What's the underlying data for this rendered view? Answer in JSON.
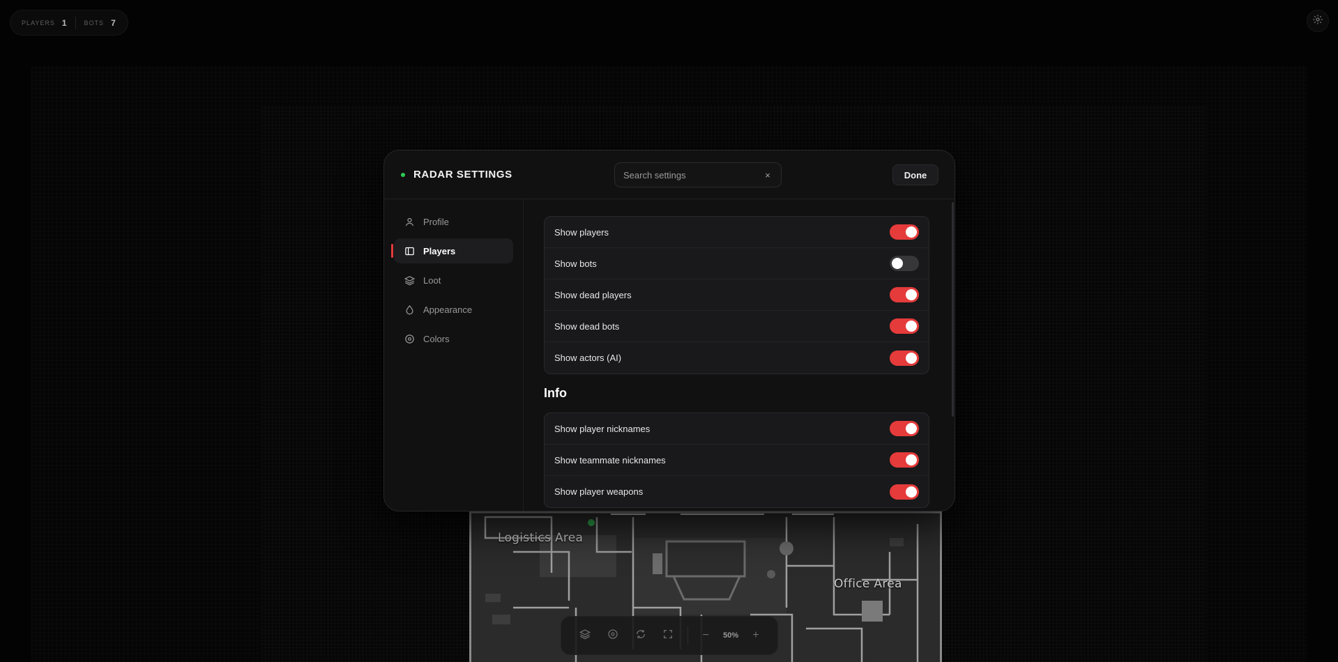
{
  "hud": {
    "players_label": "PLAYERS",
    "players_count": "1",
    "bots_label": "BOTS",
    "bots_count": "7",
    "settings_icon": "gear-icon"
  },
  "map": {
    "labels": [
      "Logistics Area",
      "Office Area"
    ]
  },
  "toolbar": {
    "buttons": [
      "layers-icon",
      "target-icon",
      "refresh-icon",
      "fullscreen-icon"
    ],
    "zoom_out": "−",
    "zoom_value": "50%",
    "zoom_in": "+"
  },
  "modal": {
    "title": "RADAR SETTINGS",
    "status_color": "#2ecc55",
    "search": {
      "placeholder": "Search settings",
      "value": "",
      "clear": "×"
    },
    "done_label": "Done",
    "nav": [
      {
        "label": "Profile",
        "icon": "user-icon",
        "active": false
      },
      {
        "label": "Players",
        "icon": "panel-icon",
        "active": true
      },
      {
        "label": "Loot",
        "icon": "layers-icon",
        "active": false
      },
      {
        "label": "Appearance",
        "icon": "droplet-icon",
        "active": false
      },
      {
        "label": "Colors",
        "icon": "target-icon",
        "active": false
      }
    ],
    "accent_color": "#e53b3b",
    "groups": [
      {
        "title": "",
        "rows": [
          {
            "label": "Show players",
            "on": true
          },
          {
            "label": "Show bots",
            "on": false
          },
          {
            "label": "Show dead players",
            "on": true
          },
          {
            "label": "Show dead bots",
            "on": true
          },
          {
            "label": "Show actors (AI)",
            "on": true
          }
        ]
      },
      {
        "title": "Info",
        "rows": [
          {
            "label": "Show player nicknames",
            "on": true
          },
          {
            "label": "Show teammate nicknames",
            "on": true
          },
          {
            "label": "Show player weapons",
            "on": true
          }
        ]
      }
    ]
  }
}
